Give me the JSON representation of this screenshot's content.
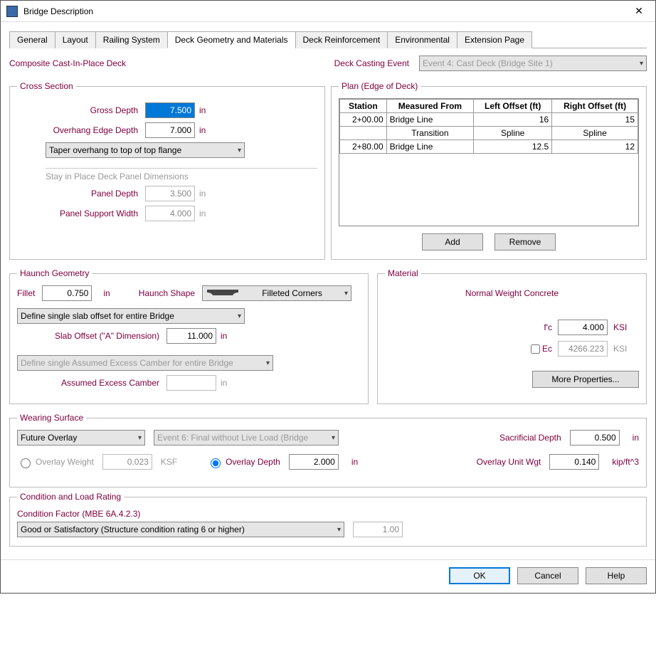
{
  "window": {
    "title": "Bridge Description"
  },
  "tabs": {
    "items": [
      {
        "label": "General"
      },
      {
        "label": "Layout"
      },
      {
        "label": "Railing System"
      },
      {
        "label": "Deck Geometry and Materials"
      },
      {
        "label": "Deck Reinforcement"
      },
      {
        "label": "Environmental"
      },
      {
        "label": "Extension Page"
      }
    ],
    "active": 3
  },
  "header": {
    "title": "Composite Cast-In-Place Deck",
    "casting_label": "Deck Casting Event",
    "casting_value": "Event 4: Cast Deck (Bridge Site 1)"
  },
  "cross_section": {
    "legend": "Cross Section",
    "gross_depth_label": "Gross Depth",
    "gross_depth_value": "7.500",
    "gross_depth_unit": "in",
    "overhang_label": "Overhang Edge Depth",
    "overhang_value": "7.000",
    "overhang_unit": "in",
    "taper_value": "Taper overhang to top of top flange",
    "sip_label": "Stay in Place Deck Panel Dimensions",
    "panel_depth_label": "Panel Depth",
    "panel_depth_value": "3.500",
    "panel_depth_unit": "in",
    "panel_support_label": "Panel Support Width",
    "panel_support_value": "4.000",
    "panel_support_unit": "in"
  },
  "plan": {
    "legend": "Plan (Edge of Deck)",
    "headers": [
      "Station",
      "Measured From",
      "Left Offset (ft)",
      "Right Offset (ft)"
    ],
    "rows": [
      {
        "station": "2+00.00",
        "from": "Bridge Line",
        "left": "16",
        "right": "15"
      },
      {
        "station": "",
        "from_center": "Transition",
        "left_center": "Spline",
        "right_center": "Spline"
      },
      {
        "station": "2+80.00",
        "from": "Bridge Line",
        "left": "12.5",
        "right": "12"
      }
    ],
    "add_label": "Add",
    "remove_label": "Remove"
  },
  "haunch": {
    "legend": "Haunch Geometry",
    "fillet_label": "Fillet",
    "fillet_value": "0.750",
    "fillet_unit": "in",
    "shape_label": "Haunch Shape",
    "shape_value": "Filleted Corners",
    "offset_scope_value": "Define single slab offset for entire Bridge",
    "slab_offset_label": "Slab Offset (\"A\" Dimension)",
    "slab_offset_value": "11.000",
    "slab_offset_unit": "in",
    "camber_scope_value": "Define single Assumed Excess Camber for entire Bridge",
    "camber_label": "Assumed Excess Camber",
    "camber_value": "",
    "camber_unit": "in"
  },
  "material": {
    "legend": "Material",
    "title": "Normal Weight Concrete",
    "fc_label": "f'c",
    "fc_value": "4.000",
    "fc_unit": "KSI",
    "ec_label": "Ec",
    "ec_value": "4266.223",
    "ec_unit": "KSI",
    "more_label": "More Properties..."
  },
  "wearing": {
    "legend": "Wearing Surface",
    "overlay_type_value": "Future Overlay",
    "event_value": "Event 6: Final without Live Load (Bridge",
    "sac_label": "Sacrificial Depth",
    "sac_value": "0.500",
    "sac_unit": "in",
    "ow_label": "Overlay Weight",
    "ow_value": "0.023",
    "ow_unit": "KSF",
    "od_label": "Overlay Depth",
    "od_value": "2.000",
    "od_unit": "in",
    "ouw_label": "Overlay Unit Wgt",
    "ouw_value": "0.140",
    "ouw_unit": "kip/ft^3"
  },
  "condition": {
    "legend": "Condition and Load Rating",
    "factor_label": "Condition Factor (MBE 6A.4.2.3)",
    "combo_value": "Good or Satisfactory (Structure condition rating 6 or higher)",
    "value": "1.00"
  },
  "buttons": {
    "ok": "OK",
    "cancel": "Cancel",
    "help": "Help"
  },
  "chart_data": {
    "type": "table",
    "columns": [
      "Station",
      "Measured From",
      "Left Offset (ft)",
      "Right Offset (ft)"
    ],
    "rows": [
      [
        "2+00.00",
        "Bridge Line",
        16,
        15
      ],
      [
        "Transition",
        "",
        "Spline",
        "Spline"
      ],
      [
        "2+80.00",
        "Bridge Line",
        12.5,
        12
      ]
    ]
  }
}
